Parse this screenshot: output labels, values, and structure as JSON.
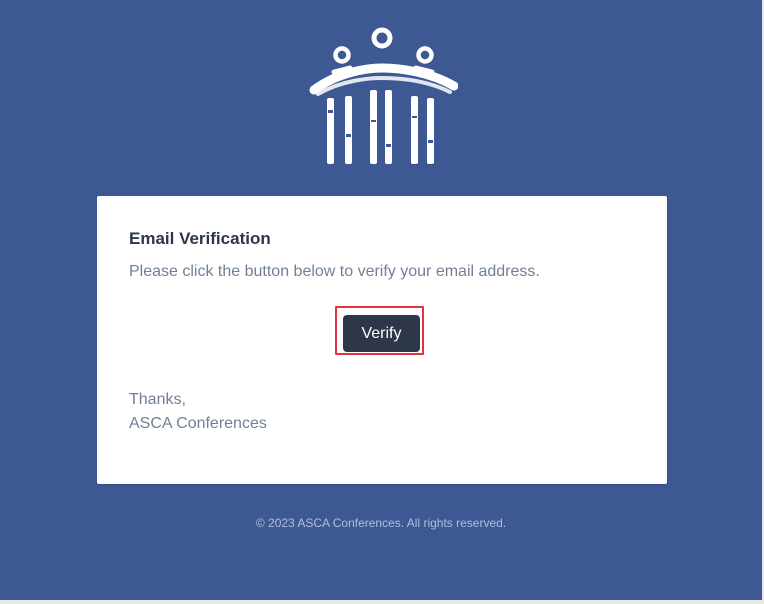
{
  "brand": {
    "logo_icon": "columns-figures-logo-icon",
    "background_color": "#3d5893",
    "text_dark": "#2d3748",
    "text_muted": "#718096",
    "highlight_color": "#e0323f"
  },
  "email": {
    "title": "Email Verification",
    "message": "Please click the button below to verify your email address.",
    "verify_label": "Verify",
    "thanks": "Thanks,",
    "signature": "ASCA Conferences"
  },
  "footer": {
    "copyright": "© 2023 ASCA Conferences. All rights reserved."
  }
}
